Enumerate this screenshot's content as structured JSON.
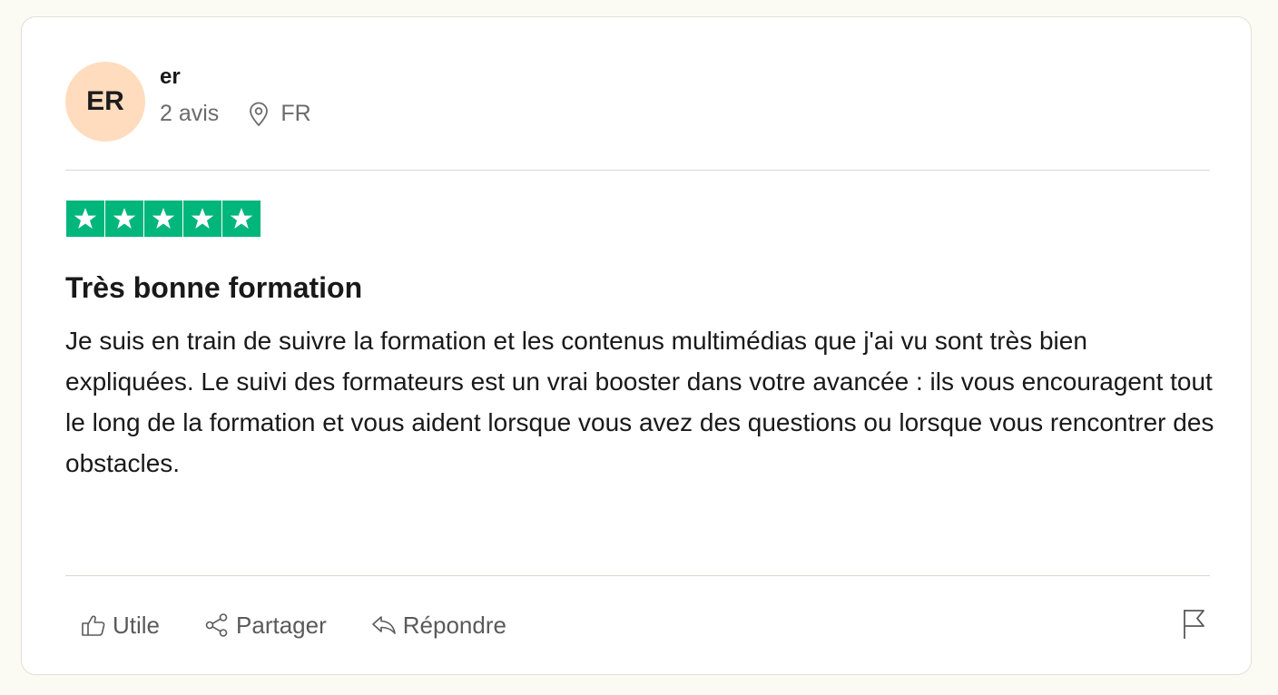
{
  "reviewer": {
    "initials": "ER",
    "name": "er",
    "review_count": "2 avis",
    "country": "FR",
    "avatar_color": "#ffdcbe"
  },
  "rating": {
    "stars": 5,
    "max": 5,
    "color": "#00b67a",
    "icon": "star-icon"
  },
  "review": {
    "title": "Très bonne formation",
    "body": "Je suis en train de suivre la formation et les contenus multimédias que j'ai vu sont très bien expliquées. Le suivi des formateurs est un vrai booster dans votre avancée : ils vous encouragent tout le long de la formation et vous aident lorsque vous avez des questions ou lorsque vous rencontrer des obstacles."
  },
  "actions": {
    "useful_label": "Utile",
    "share_label": "Partager",
    "reply_label": "Répondre",
    "icons": [
      "thumbs-up-icon",
      "share-icon",
      "reply-icon",
      "flag-icon"
    ]
  }
}
